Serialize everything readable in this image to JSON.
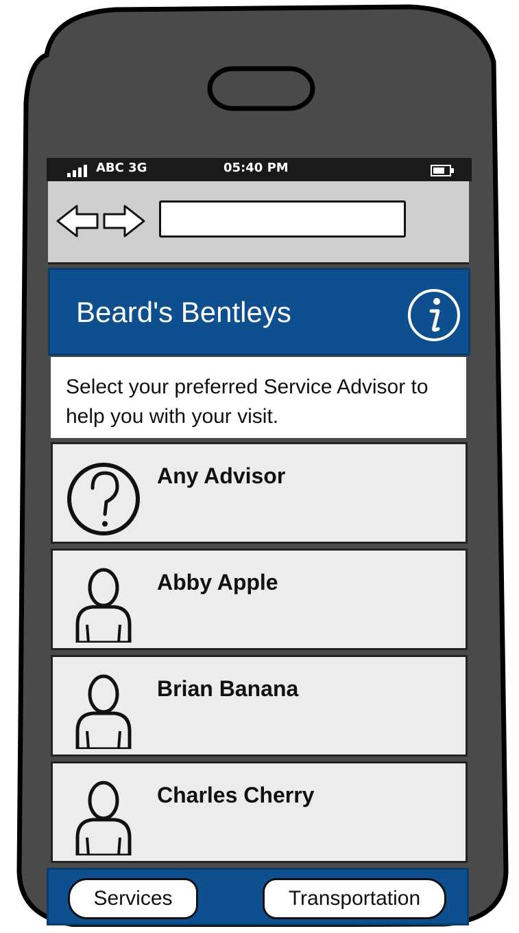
{
  "status_bar": {
    "carrier": "ABC 3G",
    "time": "05:40 PM"
  },
  "browser": {
    "back_icon": "back-arrow-icon",
    "forward_icon": "forward-arrow-icon",
    "url_value": ""
  },
  "header": {
    "title": "Beard's Bentleys",
    "info_icon": "info-icon"
  },
  "intro": {
    "text": "Select your preferred Service Advisor to help you with your visit."
  },
  "advisors": [
    {
      "name": "Any Advisor",
      "icon": "question-icon"
    },
    {
      "name": "Abby Apple",
      "icon": "person-icon"
    },
    {
      "name": "Brian Banana",
      "icon": "person-icon"
    },
    {
      "name": "Charles Cherry",
      "icon": "person-icon"
    }
  ],
  "footer": {
    "left_button": "Services",
    "right_button": "Transportation"
  },
  "colors": {
    "brand": "#0d4f8f",
    "phone_body": "#4a4a4a",
    "list_bg": "#ececec"
  }
}
